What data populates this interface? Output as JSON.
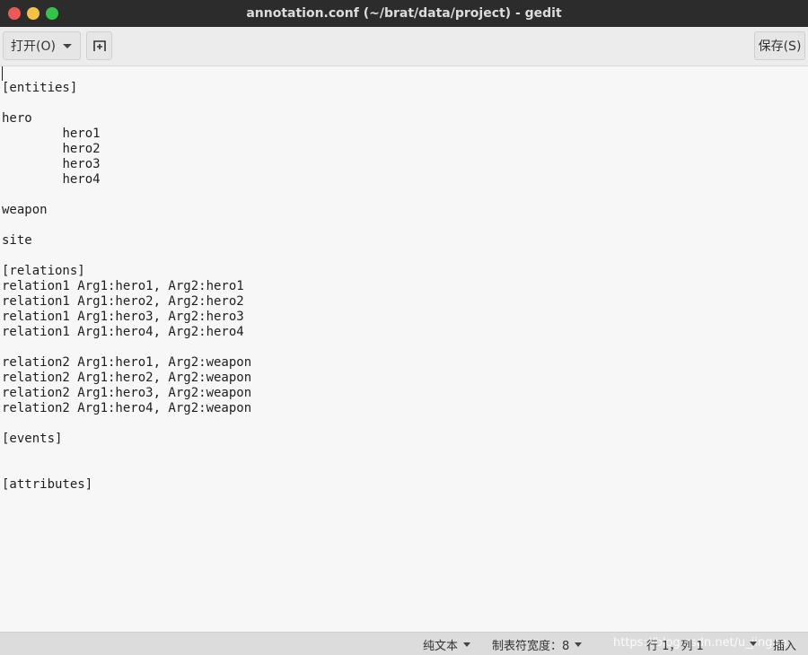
{
  "window": {
    "title": "annotation.conf (~/brat/data/project) - gedit"
  },
  "toolbar": {
    "open_label": "打开(O)",
    "save_label": "保存(S)"
  },
  "editor": {
    "content": "[entities]\n\nhero\n\thero1\n\thero2\n\thero3\n\thero4\n\nweapon\n\nsite\n\n[relations]\nrelation1 Arg1:hero1, Arg2:hero1\nrelation1 Arg1:hero2, Arg2:hero2\nrelation1 Arg1:hero3, Arg2:hero3\nrelation1 Arg1:hero4, Arg2:hero4\n\nrelation2 Arg1:hero1, Arg2:weapon\nrelation2 Arg1:hero2, Arg2:weapon\nrelation2 Arg1:hero3, Arg2:weapon\nrelation2 Arg1:hero4, Arg2:weapon\n\n[events]\n\n\n[attributes]"
  },
  "statusbar": {
    "language": "纯文本",
    "tab_width": "制表符宽度：8",
    "position": "行 1，列 1",
    "mode": "插入",
    "watermark": "https://blog.csdn.net/u_jingan"
  },
  "icons": {
    "open_dropdown": "chevron-down-icon",
    "new_tab": "new-tab-icon",
    "close": "close-icon",
    "minimize": "minimize-icon",
    "maximize": "maximize-icon"
  },
  "colors": {
    "titlebar": "#2c2c2c",
    "close": "#ec5a57",
    "minimize": "#f4c147",
    "maximize": "#35c44a",
    "editor_bg": "#f7f7f7",
    "statusbar_bg": "#dcdcdc"
  }
}
